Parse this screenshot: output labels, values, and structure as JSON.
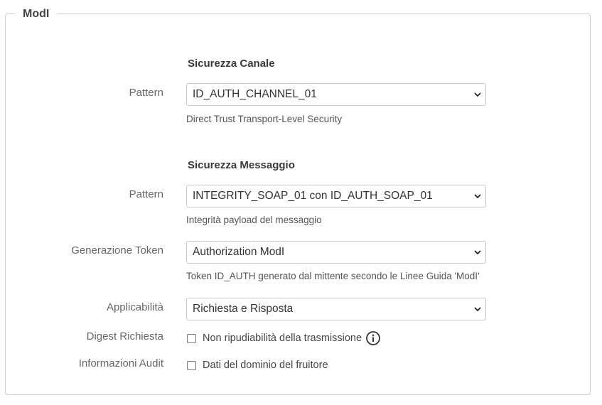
{
  "fieldset": {
    "legend": "ModI"
  },
  "canale": {
    "title": "Sicurezza Canale",
    "pattern_label": "Pattern",
    "pattern_value": "ID_AUTH_CHANNEL_01",
    "pattern_hint": "Direct Trust Transport-Level Security"
  },
  "messaggio": {
    "title": "Sicurezza Messaggio",
    "pattern_label": "Pattern",
    "pattern_value": "INTEGRITY_SOAP_01 con ID_AUTH_SOAP_01",
    "pattern_hint": "Integrità payload del messaggio",
    "token_label": "Generazione Token",
    "token_value": "Authorization ModI",
    "token_hint": "Token ID_AUTH generato dal mittente secondo le Linee Guida 'ModI'",
    "applicabilita_label": "Applicabilità",
    "applicabilita_value": "Richiesta e Risposta",
    "digest_label": "Digest Richiesta",
    "digest_checkbox_label": "Non ripudiabilità della trasmissione",
    "digest_checked": false,
    "audit_label": "Informazioni Audit",
    "audit_checkbox_label": "Dati del dominio del fruitore",
    "audit_checked": false
  },
  "icons": {
    "select_arrow": "chevron-down-icon",
    "info": "info-icon"
  }
}
